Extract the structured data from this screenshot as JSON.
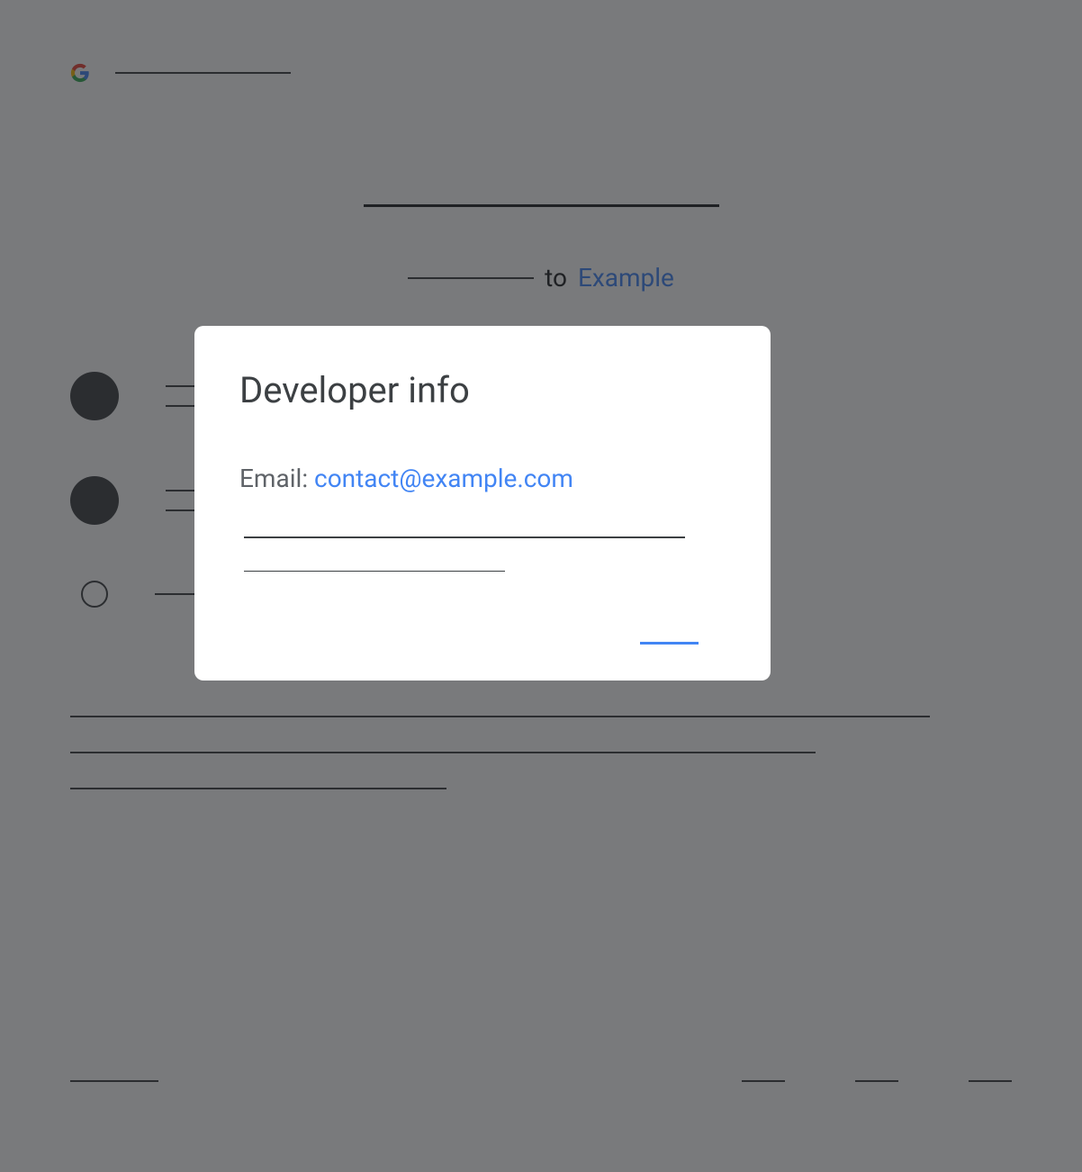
{
  "background": {
    "subtitle": {
      "to": "to",
      "link": "Example"
    }
  },
  "dialog": {
    "title": "Developer info",
    "email_label": "Email: ",
    "email_value": "contact@example.com"
  }
}
